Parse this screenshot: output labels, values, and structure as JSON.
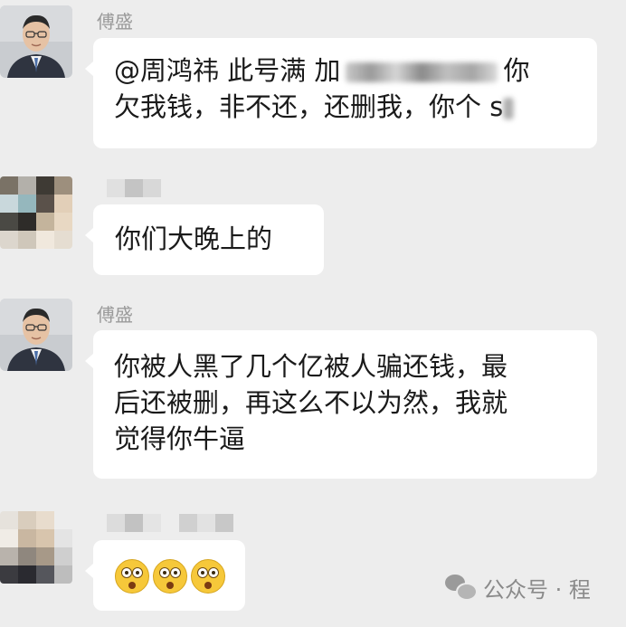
{
  "messages": [
    {
      "sender": "傅盛",
      "line1_prefix": "@周鸿祎 此号满 加",
      "line1_suffix": "你",
      "line2": "欠我钱，非不还，还删我，你个 s"
    },
    {
      "sender": "",
      "line1": "你们大晚上的"
    },
    {
      "sender": "傅盛",
      "line1": "你被人黑了几个亿被人骗还钱，最",
      "line2": "后还被删，再这么不以为然，我就",
      "line3": "觉得你牛逼"
    },
    {
      "sender": "",
      "emoji": [
        "flushed-face-emoji",
        "flushed-face-emoji",
        "flushed-face-emoji"
      ]
    }
  ],
  "watermark": {
    "icon": "wechat-icon",
    "text": "公众号 · 程"
  },
  "colors": {
    "background": "#ededed",
    "bubble": "#ffffff",
    "sender_name": "#9a9a9a",
    "emoji": "#f6c83a"
  }
}
